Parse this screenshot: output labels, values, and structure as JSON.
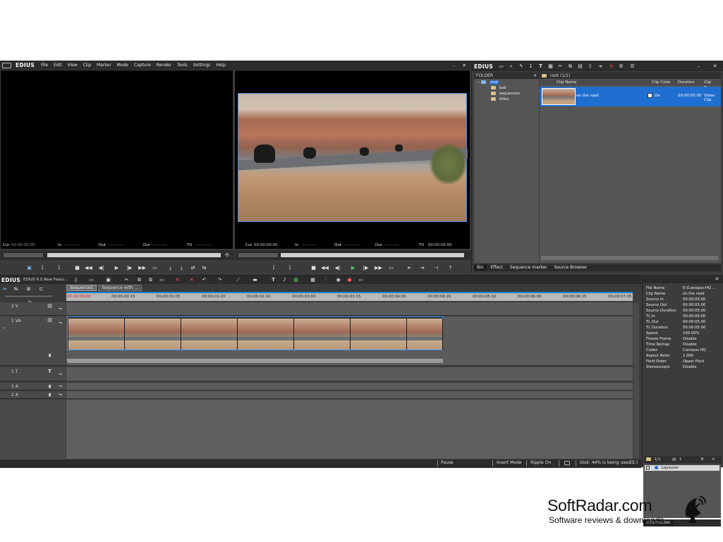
{
  "app": {
    "logo": "EDIUS",
    "menu": [
      "File",
      "Edit",
      "View",
      "Clip",
      "Marker",
      "Mode",
      "Capture",
      "Render",
      "Tools",
      "Settings",
      "Help"
    ]
  },
  "player": {
    "cur": "Cur",
    "cur_val": "00:00:00:00",
    "in": "In",
    "in_val": "--:--:--:--",
    "out": "Out",
    "out_val": "--:--:--:--",
    "dur": "Dur",
    "dur_val": "--:--:--:--",
    "ttl": "Ttl",
    "ttl_val": "--:--:--:--"
  },
  "recorder": {
    "cur": "Cur",
    "cur_val": "00:00:00:00",
    "in": "In",
    "in_val": "--:--:--:--",
    "out": "Out",
    "out_val": "--:--:--:--",
    "dur": "Dur",
    "dur_val": "--:--:--:--",
    "ttl": "Ttl",
    "ttl_val": "00:00:05:00"
  },
  "bin": {
    "logo": "EDIUS",
    "folder_header": "FOLDER",
    "root": "root",
    "folders": [
      "bali",
      "sequences",
      "titles"
    ],
    "path": "root (1/1)",
    "columns": [
      "Clip Name",
      "Clip Color",
      "Duration",
      "Clip Type"
    ],
    "clip": {
      "name": "on the road",
      "color": "De",
      "duration": "00:00:05:00",
      "type": "Video Clip"
    },
    "tabs": [
      "Bin",
      "Effect",
      "Sequence marker",
      "Source Browser"
    ]
  },
  "timeline": {
    "logo": "EDIUS",
    "project": "EDIUS 6.5 New Featu...",
    "seq_tabs": [
      "Sequence1",
      "Sequence with ..."
    ],
    "ruler": [
      "00:00:00:00",
      "00:00:00:15",
      "00:00:01:05",
      "00:00:01:20",
      "00:00:02:10",
      "00:00:03:00",
      "00:00:03:15",
      "00:00:04:05",
      "00:00:04:20",
      "00:00:05:10",
      "00:00:06:00",
      "00:00:06:15",
      "00:00:07:05"
    ],
    "tracks": {
      "v2": "2 V",
      "va1": "1 VA",
      "t1": "1 T",
      "a1": "1 A",
      "a2": "2 A"
    },
    "fx_label": "fx"
  },
  "info": {
    "rows": [
      {
        "k": "File Name",
        "v": "E:\\Canopus-HQ ..."
      },
      {
        "k": "Clip Name",
        "v": "on the road"
      },
      {
        "k": "Source In",
        "v": "00:00:00:00"
      },
      {
        "k": "Source Out",
        "v": "00:00:05:00"
      },
      {
        "k": "Source Duration",
        "v": "00:00:05:00"
      },
      {
        "k": "TL In",
        "v": "00:00:00:00"
      },
      {
        "k": "TL Out",
        "v": "00:00:05:00"
      },
      {
        "k": "TL Duration",
        "v": "00:00:05:00"
      },
      {
        "k": "Speed",
        "v": "100.00%"
      },
      {
        "k": "Freeze Frame",
        "v": "Disable"
      },
      {
        "k": "Time Remap",
        "v": "Disable"
      },
      {
        "k": "Codec",
        "v": "Canopus HQ"
      },
      {
        "k": "Aspect Ratio",
        "v": "1.000"
      },
      {
        "k": "Field Order",
        "v": "Upper Field"
      },
      {
        "k": "Stereoscopic",
        "v": "Disable"
      }
    ],
    "count": "1/1",
    "count2": "1",
    "layer": "Layouter",
    "tab": "Information"
  },
  "status": {
    "pause": "Pause",
    "insert": "Insert Mode",
    "ripple": "Ripple On",
    "disk": "Disk: 44% is being used(E:)"
  },
  "watermark": {
    "brand": "SoftRadar.com",
    "tagline": "Software reviews & downloads"
  }
}
